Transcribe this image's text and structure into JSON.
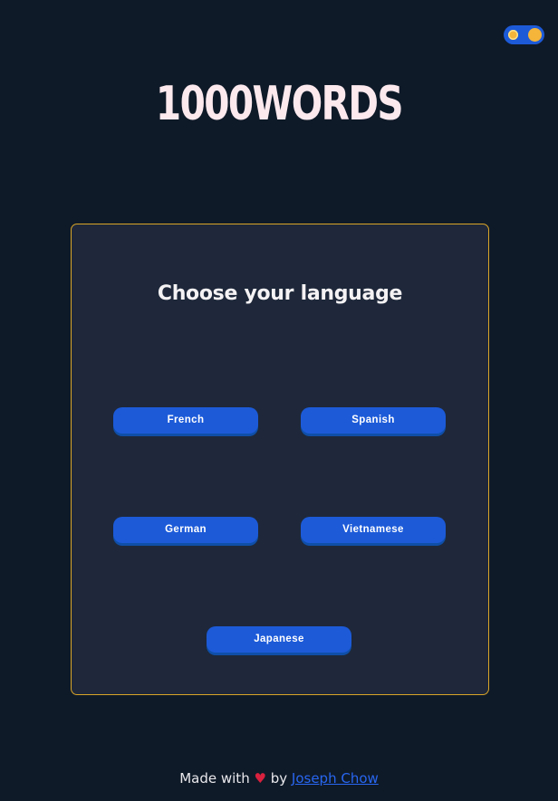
{
  "header": {
    "logo_text": "1000WORDS",
    "theme_toggle": {
      "icon": "sun-icon",
      "accent_color": "#f5b53a",
      "track_color": "#1c5ad8"
    }
  },
  "card": {
    "title": "Choose your language",
    "border_color": "#d9a528",
    "languages": [
      {
        "label": "French"
      },
      {
        "label": "Spanish"
      },
      {
        "label": "German"
      },
      {
        "label": "Vietnamese"
      },
      {
        "label": "Japanese"
      }
    ],
    "button_color": "#1c5ad8"
  },
  "footer": {
    "made_with": "Made with",
    "heart": "♥",
    "by": "by",
    "author_link": "Joseph Chow"
  },
  "colors": {
    "background": "#0f1a28",
    "card_background": "#1e283a"
  }
}
